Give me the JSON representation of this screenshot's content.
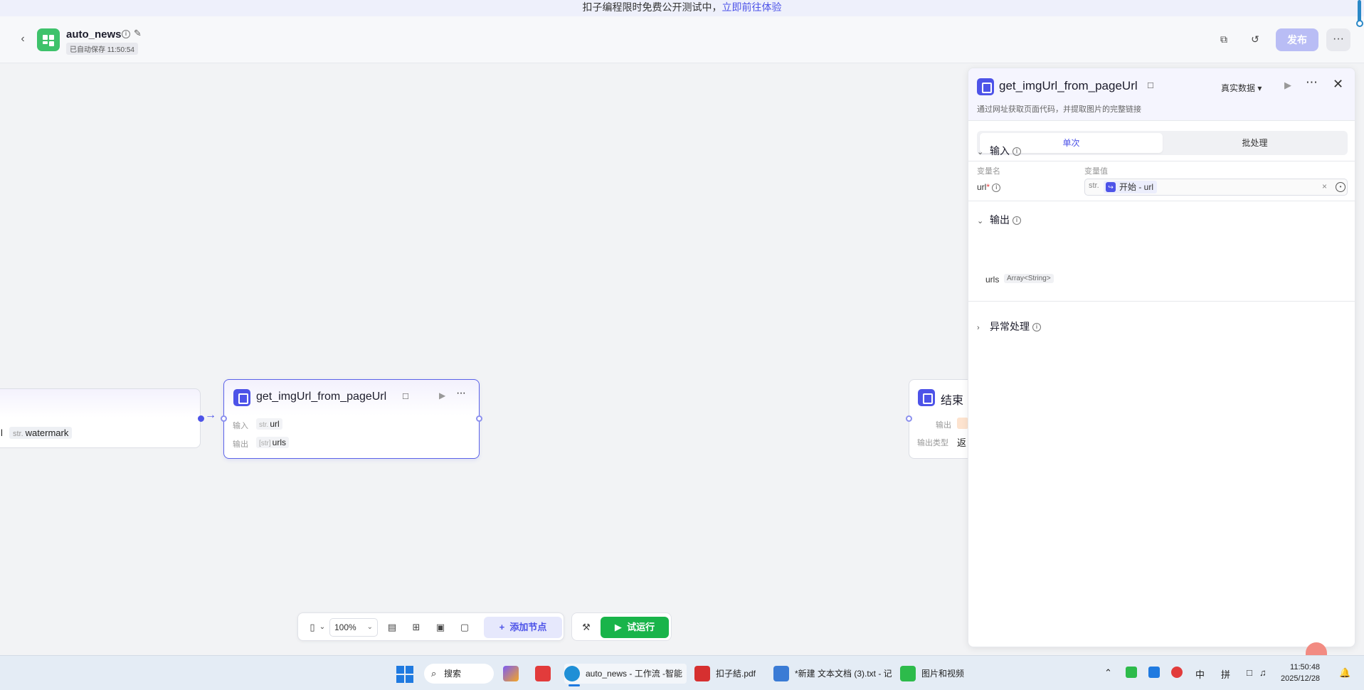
{
  "banner": {
    "text": "扣子编程限时免费公开测试中，",
    "link": "立即前往体验"
  },
  "header": {
    "app_name": "auto_news",
    "saved_status": "已自动保存 11:50:54",
    "publish_label": "发布",
    "more_label": "···"
  },
  "canvas": {
    "left_node": {
      "frag": "l",
      "chip_type": "str.",
      "chip_label": "watermark"
    },
    "main_node": {
      "title": "get_imgUrl_from_pageUrl",
      "input_label": "输入",
      "input_type": "str.",
      "input_value": "url",
      "output_label": "输出",
      "output_type": "[str]",
      "output_value": "urls",
      "more": "···"
    },
    "end_node": {
      "title": "结束",
      "output_label": "输出",
      "output_type_label": "输出类型",
      "output_type_value": "返"
    }
  },
  "panel": {
    "title": "get_imgUrl_from_pageUrl",
    "data_mode": "真实数据",
    "description": "通过网址获取页面代码，并提取图片的完整链接",
    "tabs": [
      "单次",
      "批处理"
    ],
    "input_section": "输入",
    "col_name": "变量名",
    "col_value": "变量值",
    "var_name": "url",
    "var_required": "*",
    "var_type": "str.",
    "var_ref": "开始 - url",
    "output_section": "输出",
    "output_name": "urls",
    "output_type": "Array<String>",
    "error_section": "异常处理"
  },
  "toolbar": {
    "zoom": "100%",
    "add_node": "添加节点",
    "run": "试运行"
  },
  "taskbar": {
    "search": "搜索",
    "apps": [
      {
        "label": "auto_news - 工作流 -智能"
      },
      {
        "label": "扣子結.pdf"
      },
      {
        "label": "*新建 文本文档 (3).txt - 记"
      },
      {
        "label": "图片和视频"
      }
    ],
    "ime1": "中",
    "ime2": "拼",
    "time": "11:50:48",
    "date": "2025/12/28"
  },
  "colors": {
    "accent": "#4d53e8",
    "run_green": "#19b44a",
    "publish_disabled": "#b9bdf5",
    "app_logo": "#3ec26b"
  }
}
